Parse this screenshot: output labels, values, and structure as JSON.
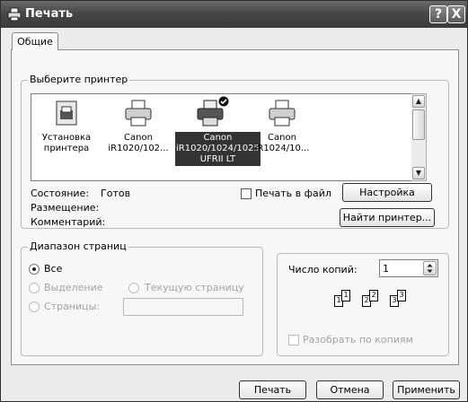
{
  "window": {
    "title": "Печать",
    "help_btn": "?",
    "close_btn": "X"
  },
  "tabs": [
    {
      "label": "Общие"
    }
  ],
  "printer_group": {
    "legend": "Выберите принтер",
    "printers": [
      {
        "name": "Установка принтера",
        "icon": "add-printer-icon",
        "selected": false
      },
      {
        "name": "Canon iR1020/102...",
        "icon": "printer-icon",
        "selected": false
      },
      {
        "name": "Canon iR1020/1024/1025 UFRII LT",
        "icon": "printer-icon",
        "selected": true,
        "default": true
      },
      {
        "name": "Canon iR1024/10...",
        "icon": "printer-icon",
        "selected": false
      }
    ],
    "status_label": "Состояние:",
    "status_value": "Готов",
    "location_label": "Размещение:",
    "comment_label": "Комментарий:",
    "print_to_file_label": "Печать в файл",
    "preferences_button": "Настройка",
    "find_printer_button": "Найти принтер..."
  },
  "page_range": {
    "legend": "Диапазон страниц",
    "all": "Все",
    "selection": "Выделение",
    "current_page": "Текущую страницу",
    "pages": "Страницы:"
  },
  "copies": {
    "label": "Число копий:",
    "value": "1",
    "collate_label": "Разобрать по копиям",
    "page_numbers": [
      "1",
      "1",
      "2",
      "2",
      "3",
      "3"
    ]
  },
  "buttons": {
    "print": "Печать",
    "cancel": "Отмена",
    "apply": "Применить"
  }
}
